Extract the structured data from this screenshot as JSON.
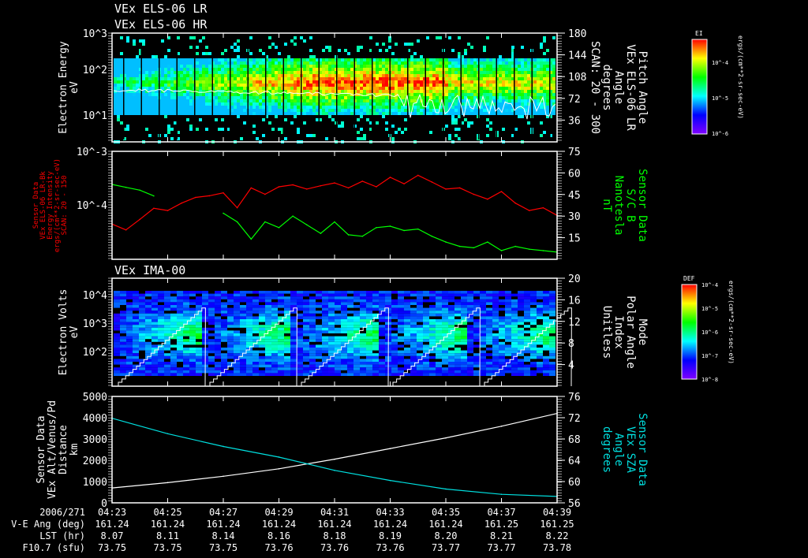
{
  "titles": {
    "p1a": "VEx ELS-06 LR",
    "p1b": "VEx ELS-06 HR",
    "p3": "VEx IMA-00"
  },
  "time_axis": {
    "date_label": "2006/271",
    "ticks": [
      "04:23",
      "04:25",
      "04:27",
      "04:29",
      "04:31",
      "04:33",
      "04:35",
      "04:37",
      "04:39"
    ],
    "rows": [
      {
        "label": "V-E Ang (deg)",
        "values": [
          "161.24",
          "161.24",
          "161.24",
          "161.24",
          "161.24",
          "161.24",
          "161.24",
          "161.25",
          "161.25"
        ]
      },
      {
        "label": "LST (hr)",
        "values": [
          "8.07",
          "8.11",
          "8.14",
          "8.16",
          "8.18",
          "8.19",
          "8.20",
          "8.21",
          "8.22"
        ]
      },
      {
        "label": "F10.7 (sfu)",
        "values": [
          "73.75",
          "73.75",
          "73.75",
          "73.76",
          "73.76",
          "73.76",
          "73.77",
          "73.77",
          "73.78"
        ]
      }
    ]
  },
  "colors": {
    "red": "#ff0000",
    "green": "#00ff00",
    "cyan": "#00e0e0",
    "white": "#ffffff"
  },
  "chart_data": [
    {
      "type": "heatmap",
      "name": "els-spectrogram",
      "ylabel": [
        "Electron Energy",
        "eV"
      ],
      "yticks": [
        "10^1",
        "10^2",
        "10^3"
      ],
      "yscale": "log",
      "ylim": [
        1,
        1000
      ],
      "y2label": [
        "Pitch Angle",
        "VEx ELS-06 LR",
        "Angle",
        "degrees",
        "SCAN: 20 - 300"
      ],
      "y2ticks": [
        "36",
        "72",
        "108",
        "144",
        "180"
      ],
      "y2lim": [
        0,
        180
      ],
      "colorbar": {
        "title": "EI",
        "ticks": [
          "10^-4",
          "10^-5",
          "10^-6"
        ],
        "unit": "ergs/(cm**2-sr-sec-eV)"
      }
    },
    {
      "type": "line",
      "name": "els-intensity-and-b",
      "x_minutes_after_0423": [
        0,
        0.5,
        1,
        1.5,
        2,
        2.5,
        3,
        3.5,
        4,
        4.5,
        5,
        5.5,
        6,
        6.5,
        7,
        7.5,
        8,
        8.5,
        9,
        9.5,
        10,
        10.5,
        11,
        11.5,
        12,
        12.5,
        13,
        13.5,
        14,
        14.5,
        15,
        15.5,
        16
      ],
      "series": [
        {
          "name": "ELS intensity",
          "color": "#ff0000",
          "axis": "left",
          "values": [
            4.5e-05,
            3.5e-05,
            5.5e-05,
            8.8e-05,
            8e-05,
            0.00011,
            0.00014,
            0.00015,
            0.00017,
            9e-05,
            0.00021,
            0.00016,
            0.00022,
            0.00024,
            0.0002,
            0.00023,
            0.00026,
            0.00021,
            0.00028,
            0.00022,
            0.00033,
            0.00025,
            0.00036,
            0.00027,
            0.0002,
            0.00021,
            0.00016,
            0.00013,
            0.00018,
            0.00011,
            8e-05,
            9e-05,
            6.5e-05
          ]
        },
        {
          "name": "S/C B",
          "color": "#00ff00",
          "axis": "right",
          "values": [
            52,
            50,
            48,
            44,
            null,
            null,
            null,
            null,
            32,
            26,
            14,
            26,
            22,
            30,
            24,
            18,
            26,
            17,
            16,
            22,
            23,
            20,
            21,
            16,
            12,
            9,
            8,
            12,
            6,
            9,
            7,
            6,
            5
          ]
        }
      ],
      "ylabel": [
        "Sensor Data",
        "VEx ELS-06 LR-Bk",
        "Energy Intensity",
        "ergs/(cm**2-sr-sec-eV)",
        "SCAN: 20 - 150"
      ],
      "yticks": [
        "10^-4",
        "10^-3"
      ],
      "yscale": "log",
      "ylim": [
        1e-05,
        0.001
      ],
      "y2label": [
        "Sensor Data",
        "S/C B",
        "Nanotesla",
        "nT"
      ],
      "y2ticks": [
        "15",
        "30",
        "45",
        "60",
        "75"
      ],
      "y2lim": [
        0,
        75
      ]
    },
    {
      "type": "heatmap",
      "name": "ima-spectrogram",
      "ylabel": [
        "Electron Volts",
        "eV"
      ],
      "yticks": [
        "10^2",
        "10^3",
        "10^4"
      ],
      "yscale": "log",
      "ylim": [
        10,
        30000
      ],
      "y2label": [
        "Mode",
        "Polar Angle",
        "Index",
        "Unitless"
      ],
      "y2ticks": [
        "4",
        "8",
        "12",
        "16",
        "20"
      ],
      "y2lim": [
        0,
        20
      ],
      "colorbar": {
        "title": "DEF",
        "ticks": [
          "10^-4",
          "10^-5",
          "10^-6",
          "10^-7",
          "10^-8"
        ],
        "unit": "ergs/(cm**2-sr-sec-eV)"
      }
    },
    {
      "type": "line",
      "name": "altitude-and-sza",
      "x_minutes_after_0423": [
        0,
        2,
        4,
        6,
        8,
        10,
        12,
        14,
        16
      ],
      "series": [
        {
          "name": "VEx Alt/Venus/Pd",
          "color": "#ffffff",
          "axis": "left",
          "values": [
            700,
            950,
            1250,
            1600,
            2050,
            2550,
            3050,
            3600,
            4200
          ]
        },
        {
          "name": "VEx SZA",
          "color": "#00e0e0",
          "axis": "right",
          "values": [
            71.9,
            69.0,
            66.6,
            64.6,
            62.1,
            60.2,
            58.6,
            57.6,
            57.2
          ]
        }
      ],
      "ylabel": [
        "Sensor Data",
        "VEx Alt/Venus/Pd",
        "Distance",
        "km"
      ],
      "yticks": [
        "0",
        "1000",
        "2000",
        "3000",
        "4000",
        "5000"
      ],
      "ylim": [
        0,
        5000
      ],
      "y2label": [
        "Sensor Data",
        "VEx SZA",
        "Angle",
        "degrees"
      ],
      "y2ticks": [
        "56",
        "60",
        "64",
        "68",
        "72",
        "76"
      ],
      "y2lim": [
        56,
        76
      ]
    }
  ]
}
